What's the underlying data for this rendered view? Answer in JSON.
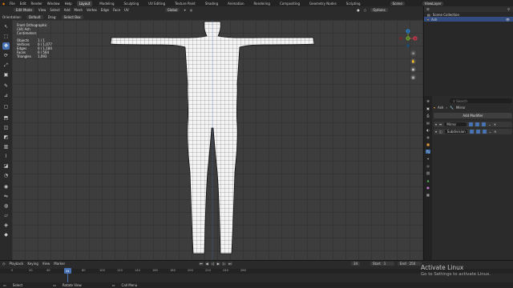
{
  "topbar": {
    "menus": [
      "File",
      "Edit",
      "Render",
      "Window",
      "Help"
    ],
    "workspaces": [
      "Layout",
      "Modeling",
      "Sculpting",
      "UV Editing",
      "Texture Paint",
      "Shading",
      "Animation",
      "Rendering",
      "Compositing",
      "Geometry Nodes",
      "Scripting"
    ],
    "active_workspace": "Layout",
    "scene_label": "Scene",
    "view_layer_label": "ViewLayer"
  },
  "viewport_header": {
    "mode": "Edit Mode",
    "menus": [
      "View",
      "Select",
      "Add",
      "Mesh",
      "Vertex",
      "Edge",
      "Face",
      "UV"
    ],
    "transform": "Global",
    "options_label": "Options"
  },
  "tool_header": {
    "orientation_label": "Orientation:",
    "orientation_value": "Default",
    "drag_label": "Drag:",
    "drag_value": "Select Box"
  },
  "overlay": {
    "view_name": "Front Orthographic",
    "object_line": "(34) Ash",
    "units": "Centimeters",
    "stats": [
      {
        "label": "Objects",
        "value": "1 / 1"
      },
      {
        "label": "Vertices",
        "value": "0 / 1,077"
      },
      {
        "label": "Edges",
        "value": "0 / 1,184"
      },
      {
        "label": "Faces",
        "value": "0 / 564"
      },
      {
        "label": "Triangles",
        "value": "1,093"
      }
    ]
  },
  "gizmo": {
    "x_label": "X",
    "y_label": "Y",
    "z_label": "Z"
  },
  "outliner": {
    "header": "Scene Collection",
    "rows": [
      {
        "label": "Scene Collection",
        "selected": false
      },
      {
        "label": "Ash",
        "selected": true
      }
    ]
  },
  "properties": {
    "search_placeholder": "Search",
    "object_name": "Ash",
    "modifier_crumb": "Mirror",
    "add_modifier_label": "Add Modifier",
    "modifiers": [
      "Mirror",
      "Subdivision"
    ]
  },
  "timeline": {
    "menus": [
      "Playback",
      "Keying",
      "View",
      "Marker"
    ],
    "current_frame": "34",
    "start_label": "Start",
    "start_value": "1",
    "end_label": "End",
    "end_value": "250",
    "ticks": [
      "0",
      "20",
      "40",
      "60",
      "80",
      "100",
      "120",
      "140",
      "160",
      "180",
      "200",
      "220",
      "240",
      "260"
    ]
  },
  "statusbar": {
    "items": [
      "Select",
      "Rotate View",
      "Call Menu"
    ]
  },
  "watermark": {
    "title": "Activate Linux",
    "subtitle": "Go to Settings to activate Linux."
  }
}
